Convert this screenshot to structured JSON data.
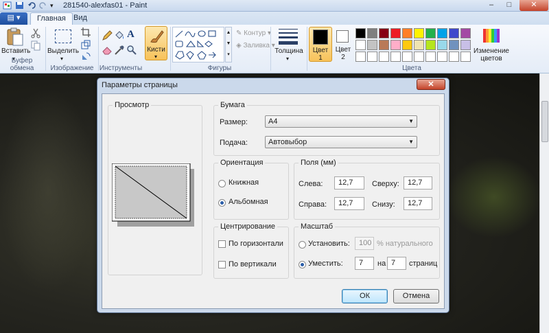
{
  "window": {
    "title": "281540-alexfas01 - Paint",
    "minimize": "–",
    "maximize": "□",
    "close": "✕"
  },
  "tabs": {
    "file": "▤ ▾",
    "home": "Главная",
    "view": "Вид"
  },
  "ribbon": {
    "paste": "Вставить",
    "clipboard_group": "Буфер обмена",
    "select": "Выделить",
    "image_group": "Изображение",
    "tools_group": "Инструменты",
    "brushes": "Кисти",
    "shapes_group": "Фигуры",
    "outline": "Контур",
    "fill": "Заливка",
    "size": "Толщина",
    "color1": "Цвет",
    "color1_num": "1",
    "color2": "Цвет",
    "color2_num": "2",
    "edit_colors_line1": "Изменение",
    "edit_colors_line2": "цветов",
    "colors_group": "Цвета",
    "palette_row1": [
      "#000000",
      "#7f7f7f",
      "#880015",
      "#ed1c24",
      "#ff7f27",
      "#fff200",
      "#22b14c",
      "#00a2e8",
      "#3f48cc",
      "#a349a4"
    ],
    "palette_row2": [
      "#ffffff",
      "#c3c3c3",
      "#b97a57",
      "#ffaec9",
      "#ffc90e",
      "#efe4b0",
      "#b5e61d",
      "#99d9ea",
      "#7092be",
      "#c8bfe7"
    ],
    "palette_row3": [
      "#ffffff",
      "#ffffff",
      "#ffffff",
      "#ffffff",
      "#ffffff",
      "#ffffff",
      "#ffffff",
      "#ffffff",
      "#ffffff",
      "#ffffff"
    ]
  },
  "dialog": {
    "title": "Параметры страницы",
    "close": "✕",
    "preview": "Просмотр",
    "paper": "Бумага",
    "size_label": "Размер:",
    "size_value": "A4",
    "source_label": "Подача:",
    "source_value": "Автовыбор",
    "orientation": "Ориентация",
    "portrait": "Книжная",
    "landscape": "Альбомная",
    "margins": "Поля (мм)",
    "left_label": "Слева:",
    "left_value": "12,7",
    "top_label": "Сверху:",
    "top_value": "12,7",
    "right_label": "Справа:",
    "right_value": "12,7",
    "bottom_label": "Снизу:",
    "bottom_value": "12,7",
    "centering": "Центрирование",
    "horizontal": "По горизонтали",
    "vertical": "По вертикали",
    "scale": "Масштаб",
    "adjust_label": "Установить:",
    "adjust_value": "100",
    "adjust_suffix": "% натурального",
    "fit_label": "Уместить:",
    "fit_w": "7",
    "fit_by": "на",
    "fit_h": "7",
    "fit_suffix": "страниц",
    "ok": "ОК",
    "cancel": "Отмена"
  }
}
